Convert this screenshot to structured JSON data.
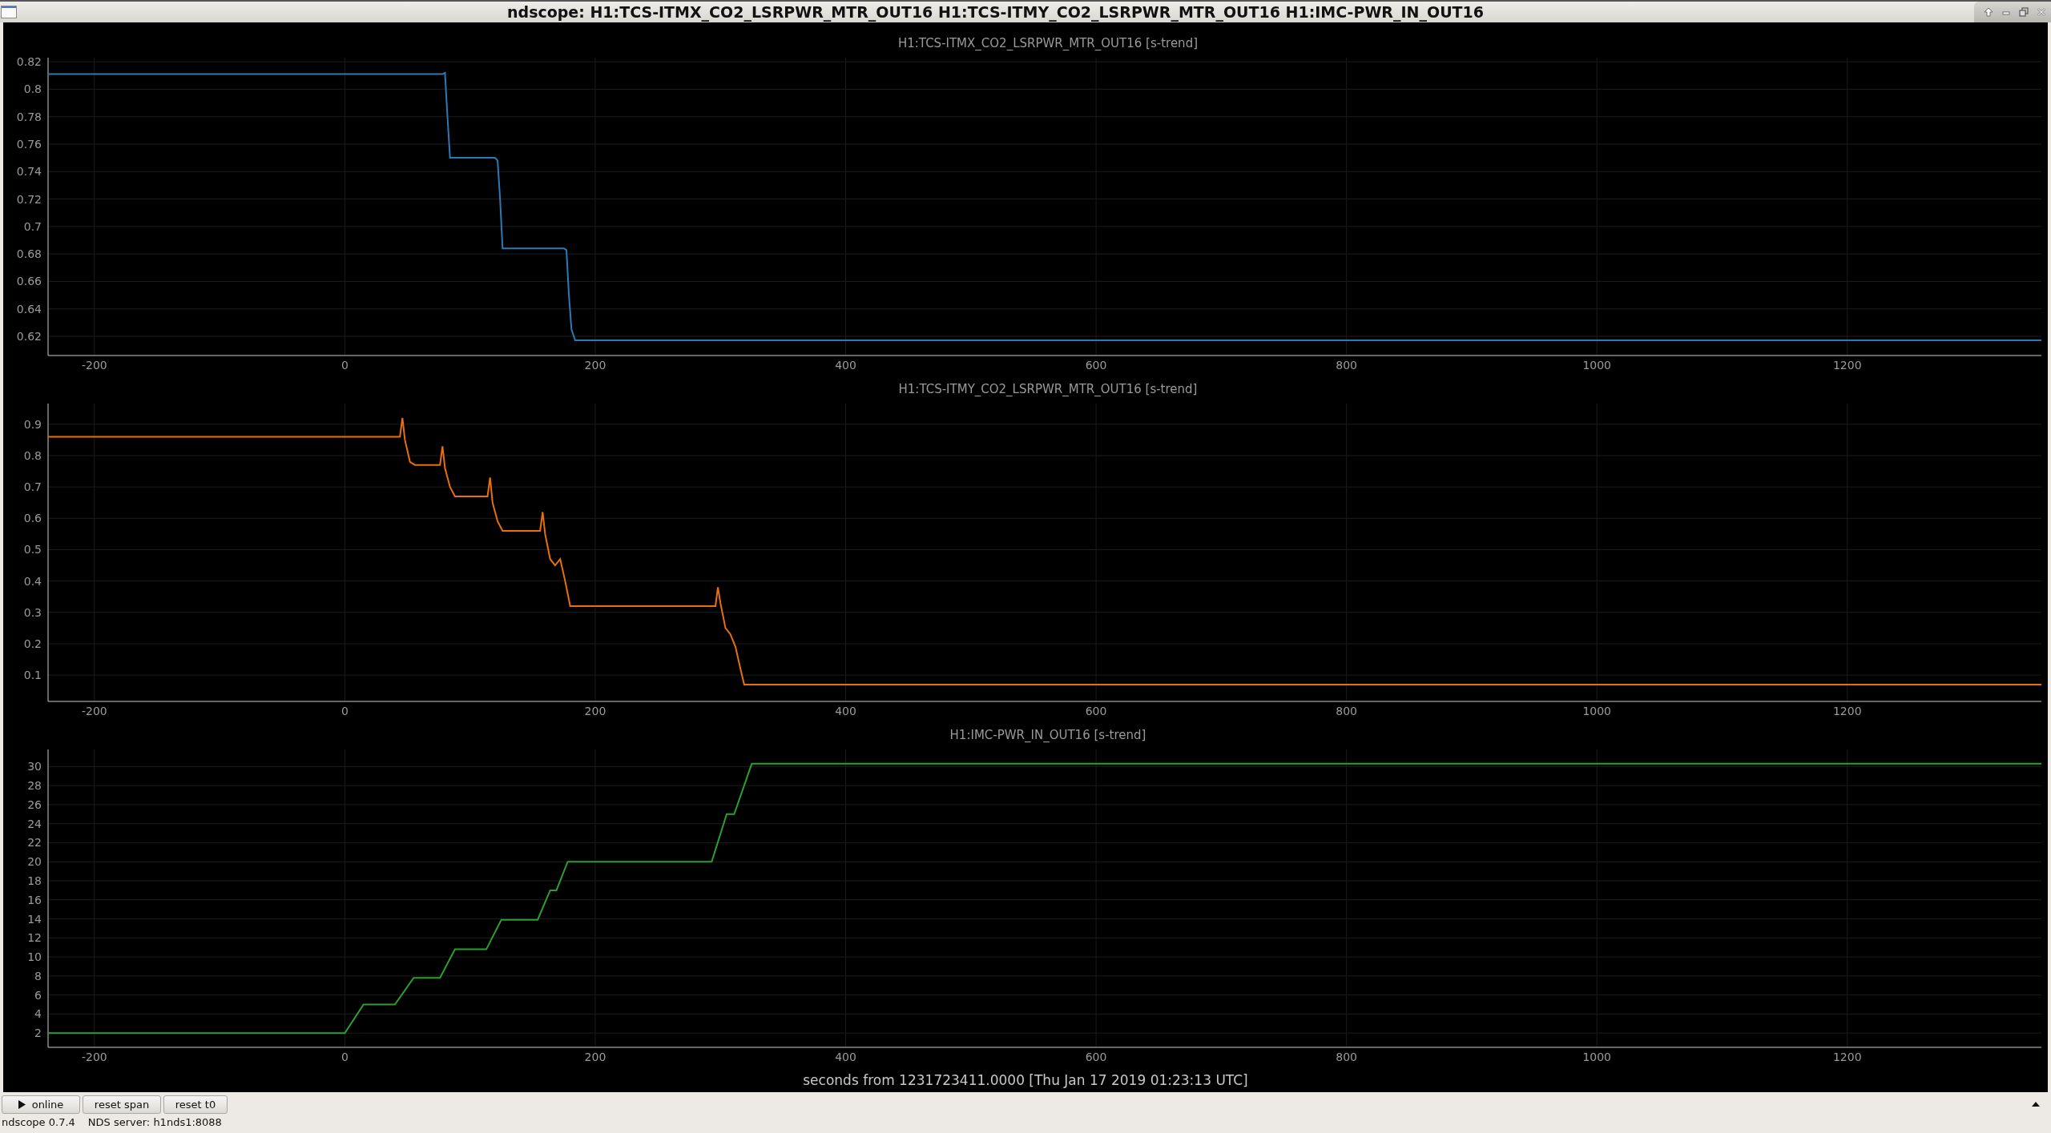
{
  "window": {
    "title": "ndscope: H1:TCS-ITMX_CO2_LSRPWR_MTR_OUT16 H1:TCS-ITMY_CO2_LSRPWR_MTR_OUT16 H1:IMC-PWR_IN_OUT16"
  },
  "plots": [
    {
      "chart_data": {
        "type": "line",
        "title": "H1:TCS-ITMX_CO2_LSRPWR_MTR_OUT16 [s-trend]",
        "x": [
          -237,
          78,
          80,
          82,
          84,
          120,
          122,
          124,
          126,
          175,
          177,
          179,
          181,
          184,
          1355
        ],
        "series": [
          {
            "color": "#2a7ab8",
            "values": [
              0.811,
              0.811,
              0.812,
              0.78,
              0.75,
              0.75,
              0.748,
              0.72,
              0.684,
              0.684,
              0.683,
              0.65,
              0.625,
              0.617,
              0.617
            ]
          }
        ],
        "grid": true,
        "xlim": [
          -237,
          1355
        ],
        "ylim": [
          0.606,
          0.823
        ],
        "xticks": [
          -200,
          0,
          200,
          400,
          600,
          800,
          1000,
          1200
        ],
        "yticks": [
          0.62,
          0.64,
          0.66,
          0.68,
          0.7,
          0.72,
          0.74,
          0.76,
          0.78,
          0.8,
          0.82
        ]
      }
    },
    {
      "chart_data": {
        "type": "line",
        "title": "H1:TCS-ITMY_CO2_LSRPWR_MTR_OUT16 [s-trend]",
        "x": [
          -237,
          44,
          46,
          48,
          52,
          56,
          76,
          78,
          80,
          84,
          88,
          114,
          116,
          118,
          122,
          126,
          156,
          158,
          160,
          164,
          168,
          172,
          176,
          180,
          296,
          298,
          300,
          304,
          308,
          312,
          316,
          319,
          1355
        ],
        "series": [
          {
            "color": "#e8700c",
            "values": [
              0.86,
              0.86,
              0.92,
              0.85,
              0.78,
              0.77,
              0.77,
              0.83,
              0.76,
              0.7,
              0.67,
              0.67,
              0.73,
              0.65,
              0.59,
              0.56,
              0.56,
              0.62,
              0.55,
              0.47,
              0.45,
              0.47,
              0.4,
              0.32,
              0.32,
              0.38,
              0.33,
              0.25,
              0.23,
              0.19,
              0.12,
              0.07,
              0.07
            ]
          }
        ],
        "grid": true,
        "xlim": [
          -237,
          1355
        ],
        "ylim": [
          0.016,
          0.966
        ],
        "xticks": [
          -200,
          0,
          200,
          400,
          600,
          800,
          1000,
          1200
        ],
        "yticks": [
          0.1,
          0.2,
          0.3,
          0.4,
          0.5,
          0.6,
          0.7,
          0.8,
          0.9
        ]
      }
    },
    {
      "chart_data": {
        "type": "line",
        "title": "H1:IMC-PWR_IN_OUT16 [s-trend]",
        "x": [
          -237,
          0,
          15,
          40,
          55,
          76,
          88,
          113,
          125,
          154,
          164,
          169,
          178,
          293,
          305,
          311,
          325,
          1355
        ],
        "series": [
          {
            "color": "#2ca02c",
            "values": [
              2,
              2,
              5,
              5,
              7.8,
              7.8,
              10.8,
              10.8,
              13.9,
              13.9,
              17,
              17,
              20,
              20,
              25,
              25,
              30.3,
              30.3
            ]
          }
        ],
        "grid": true,
        "xlim": [
          -237,
          1355
        ],
        "ylim": [
          0.5,
          31.8
        ],
        "xticks": [
          -200,
          0,
          200,
          400,
          600,
          800,
          1000,
          1200
        ],
        "yticks": [
          2,
          4,
          6,
          8,
          10,
          12,
          14,
          16,
          18,
          20,
          22,
          24,
          26,
          28,
          30
        ]
      }
    }
  ],
  "time_axis_label": "seconds from 1231723411.0000 [Thu Jan 17 2019 01:23:13 UTC]",
  "buttons": [
    {
      "kind": "play",
      "label": "online"
    },
    {
      "kind": "plain",
      "label": "reset span"
    },
    {
      "kind": "plain",
      "label": "reset t0"
    }
  ],
  "status_bar": {
    "version": "ndscope 0.7.4",
    "server": "NDS server: h1nds1:8088"
  }
}
